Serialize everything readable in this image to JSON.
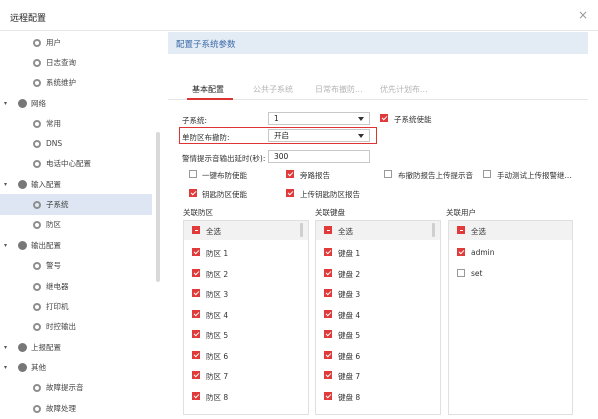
{
  "window": {
    "title": "远程配置",
    "close": "×"
  },
  "sidebar": {
    "items": [
      {
        "label": "用户",
        "level": 1
      },
      {
        "label": "日志查询",
        "level": 1
      },
      {
        "label": "系统维护",
        "level": 1
      },
      {
        "label": "网络",
        "level": 0
      },
      {
        "label": "常用",
        "level": 1
      },
      {
        "label": "DNS",
        "level": 1
      },
      {
        "label": "电话中心配置",
        "level": 1
      },
      {
        "label": "输入配置",
        "level": 0
      },
      {
        "label": "子系统",
        "level": 1,
        "active": true
      },
      {
        "label": "防区",
        "level": 1
      },
      {
        "label": "输出配置",
        "level": 0
      },
      {
        "label": "警号",
        "level": 1
      },
      {
        "label": "继电器",
        "level": 1
      },
      {
        "label": "打印机",
        "level": 1
      },
      {
        "label": "时控输出",
        "level": 1
      },
      {
        "label": "上报配置",
        "level": 0
      },
      {
        "label": "其他",
        "level": 0
      },
      {
        "label": "故障提示音",
        "level": 1
      },
      {
        "label": "故障处理",
        "level": 1
      }
    ]
  },
  "panel": {
    "header": "配置子系统参数",
    "tabs": [
      "基本配置",
      "公共子系统",
      "日常布撤防...",
      "优先计划布..."
    ],
    "subsystem_label": "子系统:",
    "subsystem_value": "1",
    "subsystem_enable_label": "子系统使能",
    "single_zone_label": "单防区布撤防:",
    "single_zone_value": "开启",
    "alarm_delay_label": "警情提示音输出延时(秒):",
    "alarm_delay_value": "300",
    "options": [
      {
        "label": "一键布防使能",
        "checked": false
      },
      {
        "label": "旁路报告",
        "checked": true
      },
      {
        "label": "布撤防报告上传提示音",
        "checked": false
      },
      {
        "label": "手动测试上传报警继...",
        "checked": false
      },
      {
        "label": "钥匙防区使能",
        "checked": true
      },
      {
        "label": "上传钥匙防区报告",
        "checked": true
      }
    ],
    "zones": {
      "title": "关联防区",
      "select_all": "全选",
      "items": [
        "防区 1",
        "防区 2",
        "防区 3",
        "防区 4",
        "防区 5",
        "防区 6",
        "防区 7",
        "防区 8"
      ]
    },
    "keypads": {
      "title": "关联键盘",
      "select_all": "全选",
      "items": [
        "键盘 1",
        "键盘 2",
        "键盘 3",
        "键盘 4",
        "键盘 5",
        "键盘 6",
        "键盘 7",
        "键盘 8"
      ]
    },
    "users": {
      "title": "关联用户",
      "select_all": "全选",
      "items": [
        {
          "label": "admin",
          "checked": true
        },
        {
          "label": "set",
          "checked": false
        }
      ]
    }
  }
}
